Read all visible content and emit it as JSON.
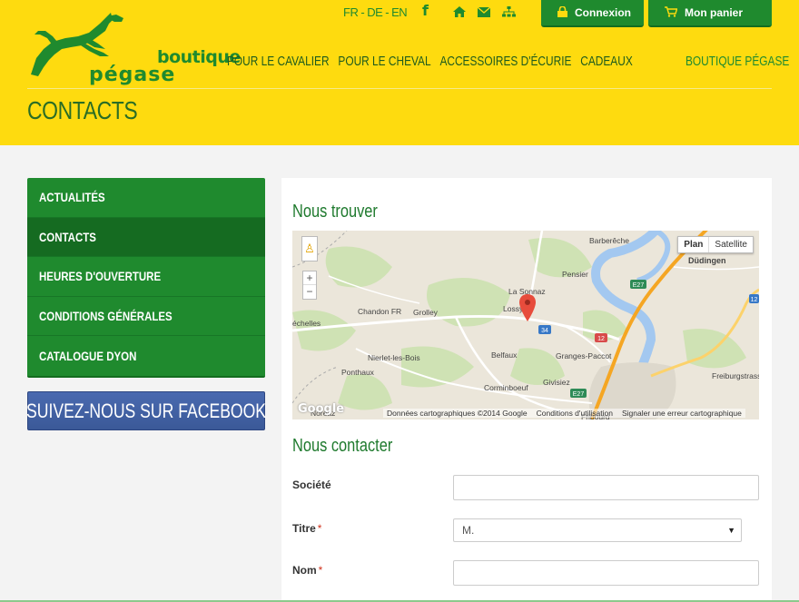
{
  "logo": {
    "line1": "boutique",
    "line2": "pégase"
  },
  "languages": [
    "FR",
    "DE",
    "EN"
  ],
  "top_icons": [
    "facebook-icon",
    "home-icon",
    "mail-icon",
    "sitemap-icon"
  ],
  "buttons": {
    "login": "Connexion",
    "cart": "Mon panier"
  },
  "nav": {
    "items": [
      "POUR LE CAVALIER",
      "POUR LE CHEVAL",
      "ACCESSOIRES D'ÉCURIE",
      "CADEAUX"
    ],
    "right": "BOUTIQUE PÉGASE"
  },
  "page_title": "CONTACTS",
  "sidebar": {
    "items": [
      "ACTUALITÉS",
      "CONTACTS",
      "HEURES D'OUVERTURE",
      "CONDITIONS GÉNÉRALES",
      "CATALOGUE DYON"
    ],
    "active": "CONTACTS",
    "facebook_banner": "SUIVEZ-NOUS SUR FACEBOOK"
  },
  "main": {
    "find_title": "Nous trouver",
    "contact_title": "Nous contacter",
    "map": {
      "type_plan": "Plan",
      "type_satellite": "Satellite",
      "zoom_in": "+",
      "zoom_out": "−",
      "google": "Google",
      "footer_data": "Données cartographiques ©2014 Google",
      "footer_terms": "Conditions d'utilisation",
      "footer_report": "Signaler une erreur cartographique",
      "places": [
        "Barberêche",
        "Düdingen",
        "Pensier",
        "La Sonnaz",
        "Lossy",
        "Chandon FR",
        "Grolley",
        "échelles",
        "Nierlet-les-Bois",
        "Belfaux",
        "Granges-Paccot",
        "Ponthaux",
        "Corminboeuf",
        "Givisiez",
        "Fribourg",
        "Freiburgstrasse",
        "Noréaz"
      ],
      "roads": [
        "E27",
        "E27",
        "12",
        "12",
        "34"
      ]
    },
    "form": {
      "societe_label": "Société",
      "titre_label": "Titre",
      "titre_value": "M.",
      "nom_label": "Nom",
      "required_mark": "*"
    }
  },
  "colors": {
    "header_yellow": "#fedb0f",
    "brand_green": "#1f8a2e",
    "sidebar_active": "#156b21",
    "facebook_blue": "#3b5998"
  }
}
